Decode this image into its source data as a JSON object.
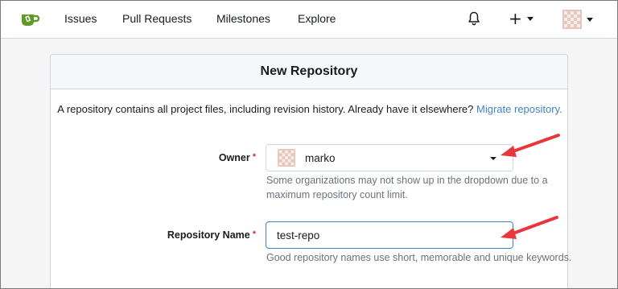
{
  "navbar": {
    "logo": "gitea-logo",
    "items": [
      {
        "label": "Issues"
      },
      {
        "label": "Pull Requests"
      },
      {
        "label": "Milestones"
      },
      {
        "label": "Explore"
      }
    ],
    "notifications_icon": "bell-icon",
    "create_icon": "plus-icon",
    "avatar_icon": "user-avatar"
  },
  "page": {
    "title": "New Repository",
    "intro_text": "A repository contains all project files, including revision history. Already have it elsewhere?",
    "intro_link": "Migrate repository."
  },
  "form": {
    "owner": {
      "label": "Owner",
      "value": "marko",
      "help": "Some organizations may not show up in the dropdown due to a maximum repository count limit."
    },
    "repo_name": {
      "label": "Repository Name",
      "value": "test-repo",
      "help": "Good repository names use short, memorable and unique keywords."
    },
    "required_marker": "*"
  },
  "colors": {
    "accent": "#4183c4",
    "logo_green": "#609926",
    "required": "#db2828",
    "annotation_arrow": "#e8363c"
  }
}
